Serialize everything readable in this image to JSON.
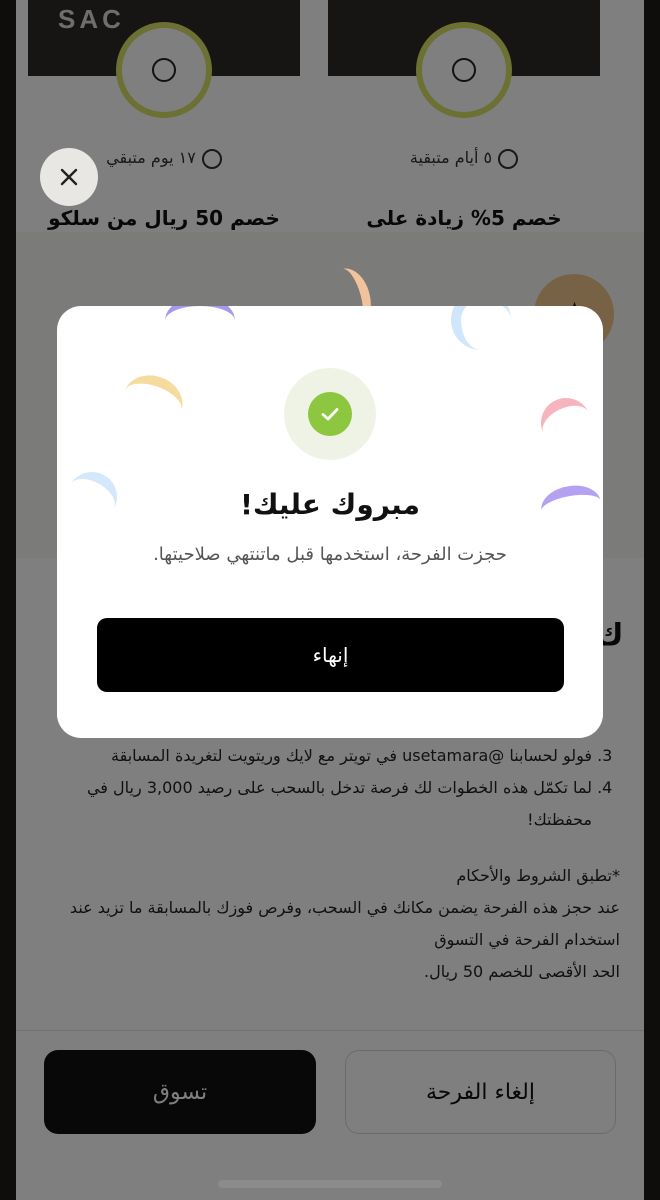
{
  "background": {
    "offers": [
      {
        "brand": "SAC",
        "expiry": "١٧ يوم متبقي",
        "title": "خصم 50 ريال من سلكو"
      },
      {
        "brand": "",
        "expiry": "٥ أيام متبقية",
        "title": "خصم 5% زيادة على"
      }
    ],
    "heading_fragment": "ك",
    "terms": {
      "steps": [
        "فولو لحسابنا @usetamara في تويتر مع لايك وريتويت لتغريدة المسابقة",
        "لما تكمّل هذه الخطوات لك فرصة تدخل بالسحب على رصيد 3,000 ريال في محفظتك!"
      ],
      "notes": [
        "*تطبق الشروط والأحكام",
        "عند حجز هذه الفرحة يضمن مكانك في السحب، وفرص فوزك بالمسابقة ما تزيد عند استخدام الفرحة في التسوق",
        "الحد الأقصى للخصم 50 ريال."
      ]
    },
    "footer": {
      "shop_label": "تسوق",
      "cancel_label": "إلغاء الفرحة"
    }
  },
  "modal": {
    "title": "مبروك عليك!",
    "subtitle": "حجزت الفرحة، استخدمها قبل ماتنتهي صلاحيتها.",
    "finish_label": "إنهاء",
    "accent_color": "#8dc63f"
  },
  "icons": {
    "close": "close-icon",
    "check": "checkmark-icon"
  }
}
